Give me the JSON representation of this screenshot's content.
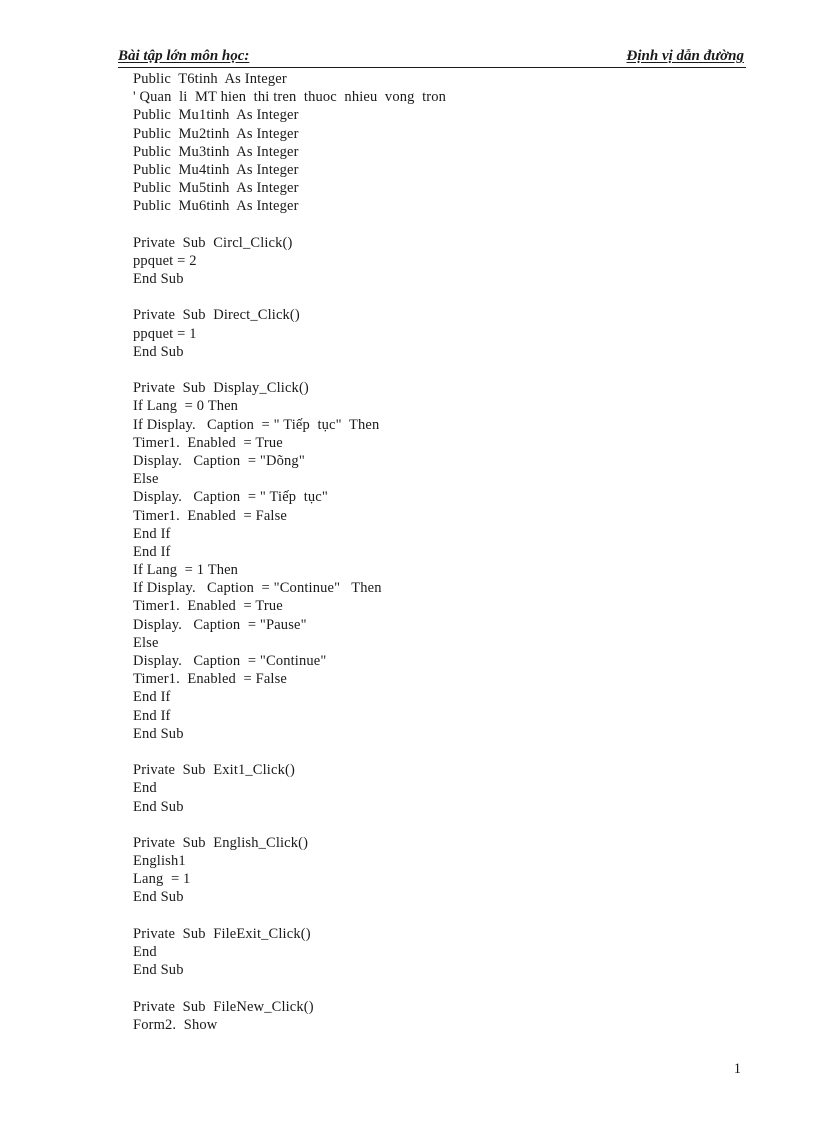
{
  "header": {
    "left_text": "Bài tập lớn môn học:",
    "right_text": "Định vị dẫn đường"
  },
  "footer": {
    "page_number": "1"
  },
  "code": {
    "language": "Visual Basic",
    "lines": [
      "Public  T6tinh  As Integer",
      "' Quan  li  MT hien  thi tren  thuoc  nhieu  vong  tron",
      "Public  Mu1tinh  As Integer",
      "Public  Mu2tinh  As Integer",
      "Public  Mu3tinh  As Integer",
      "Public  Mu4tinh  As Integer",
      "Public  Mu5tinh  As Integer",
      "Public  Mu6tinh  As Integer",
      "",
      "Private  Sub  Circl_Click()",
      "ppquet = 2",
      "End Sub",
      "",
      "Private  Sub  Direct_Click()",
      "ppquet = 1",
      "End Sub",
      "",
      "Private  Sub  Display_Click()",
      "If Lang  = 0 Then",
      "If Display.   Caption  = \" Tiếp  tục\"  Then",
      "Timer1.  Enabled  = True",
      "Display.   Caption  = \"Dõng\"",
      "Else",
      "Display.   Caption  = \" Tiếp  tục\"",
      "Timer1.  Enabled  = False",
      "End If",
      "End If",
      "If Lang  = 1 Then",
      "If Display.   Caption  = \"Continue\"   Then",
      "Timer1.  Enabled  = True",
      "Display.   Caption  = \"Pause\"",
      "Else",
      "Display.   Caption  = \"Continue\"",
      "Timer1.  Enabled  = False",
      "End If",
      "End If",
      "End Sub",
      "",
      "Private  Sub  Exit1_Click()",
      "End",
      "End Sub",
      "",
      "Private  Sub  English_Click()",
      "English1",
      "Lang  = 1",
      "End Sub",
      "",
      "Private  Sub  FileExit_Click()",
      "End",
      "End Sub",
      "",
      "Private  Sub  FileNew_Click()",
      "Form2.  Show"
    ]
  }
}
